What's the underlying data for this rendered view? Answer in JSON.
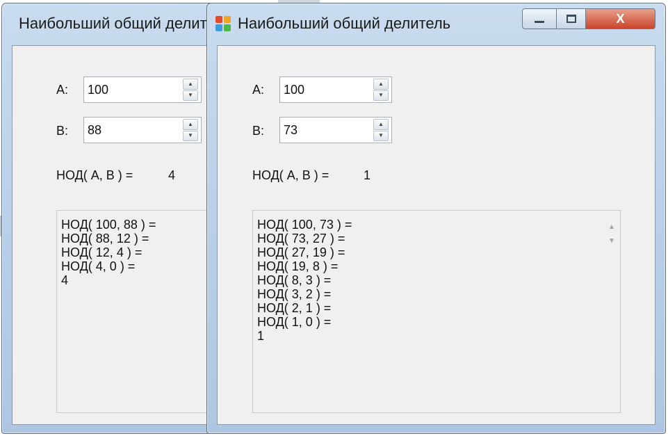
{
  "back_window": {
    "title": "Наибольший общий делитель",
    "a_label": "A:",
    "b_label": "B:",
    "a_value": "100",
    "b_value": "88",
    "result_label": "НОД( A, B ) =",
    "result_value": "4",
    "log_lines": [
      "НОД( 100, 88 ) =",
      "НОД( 88, 12 ) =",
      "НОД( 12, 4 ) =",
      "НОД( 4, 0 ) =",
      "4"
    ]
  },
  "front_window": {
    "title": "Наибольший общий делитель",
    "a_label": "A:",
    "b_label": "B:",
    "a_value": "100",
    "b_value": "73",
    "result_label": "НОД( A, B ) =",
    "result_value": "1",
    "log_lines": [
      "НОД( 100, 73 ) =",
      "НОД( 73, 27 ) =",
      "НОД( 27, 19 ) =",
      "НОД( 19, 8 ) =",
      "НОД( 8, 3 ) =",
      "НОД( 3, 2 ) =",
      "НОД( 2, 1 ) =",
      "НОД( 1, 0 ) =",
      "1"
    ],
    "close_glyph": "X"
  },
  "icons": {
    "app": "winforms-app-icon",
    "spin_up": "▲",
    "spin_down": "▼",
    "scroll_up": "▲",
    "scroll_down": "▼"
  },
  "colors": {
    "titlebar": "#bcd2ea",
    "client": "#f0f0f0",
    "close_button": "#c8452a"
  }
}
